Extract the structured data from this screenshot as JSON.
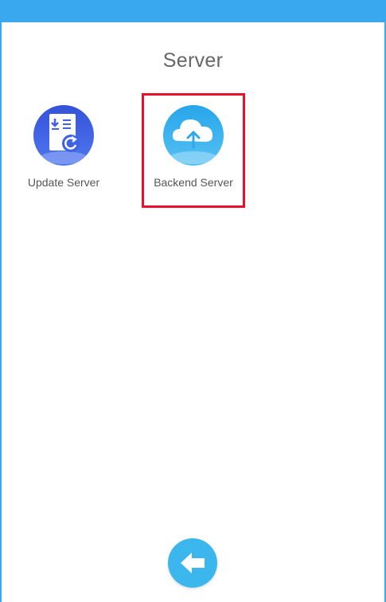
{
  "window": {
    "title": "Server"
  },
  "tiles": [
    {
      "label": "Update Server",
      "icon": "update-document-icon"
    },
    {
      "label": "Backend Server",
      "icon": "cloud-upload-icon",
      "highlighted": true
    }
  ],
  "footer": {
    "back_icon": "back-arrow-icon"
  },
  "colors": {
    "top_bar": "#3aa8ee",
    "update_icon": "#3f63e6",
    "backend_icon": "#2ea7ec",
    "highlight_border": "#e8112d",
    "back_button": "#3bb7ee",
    "title_text": "#666666"
  }
}
